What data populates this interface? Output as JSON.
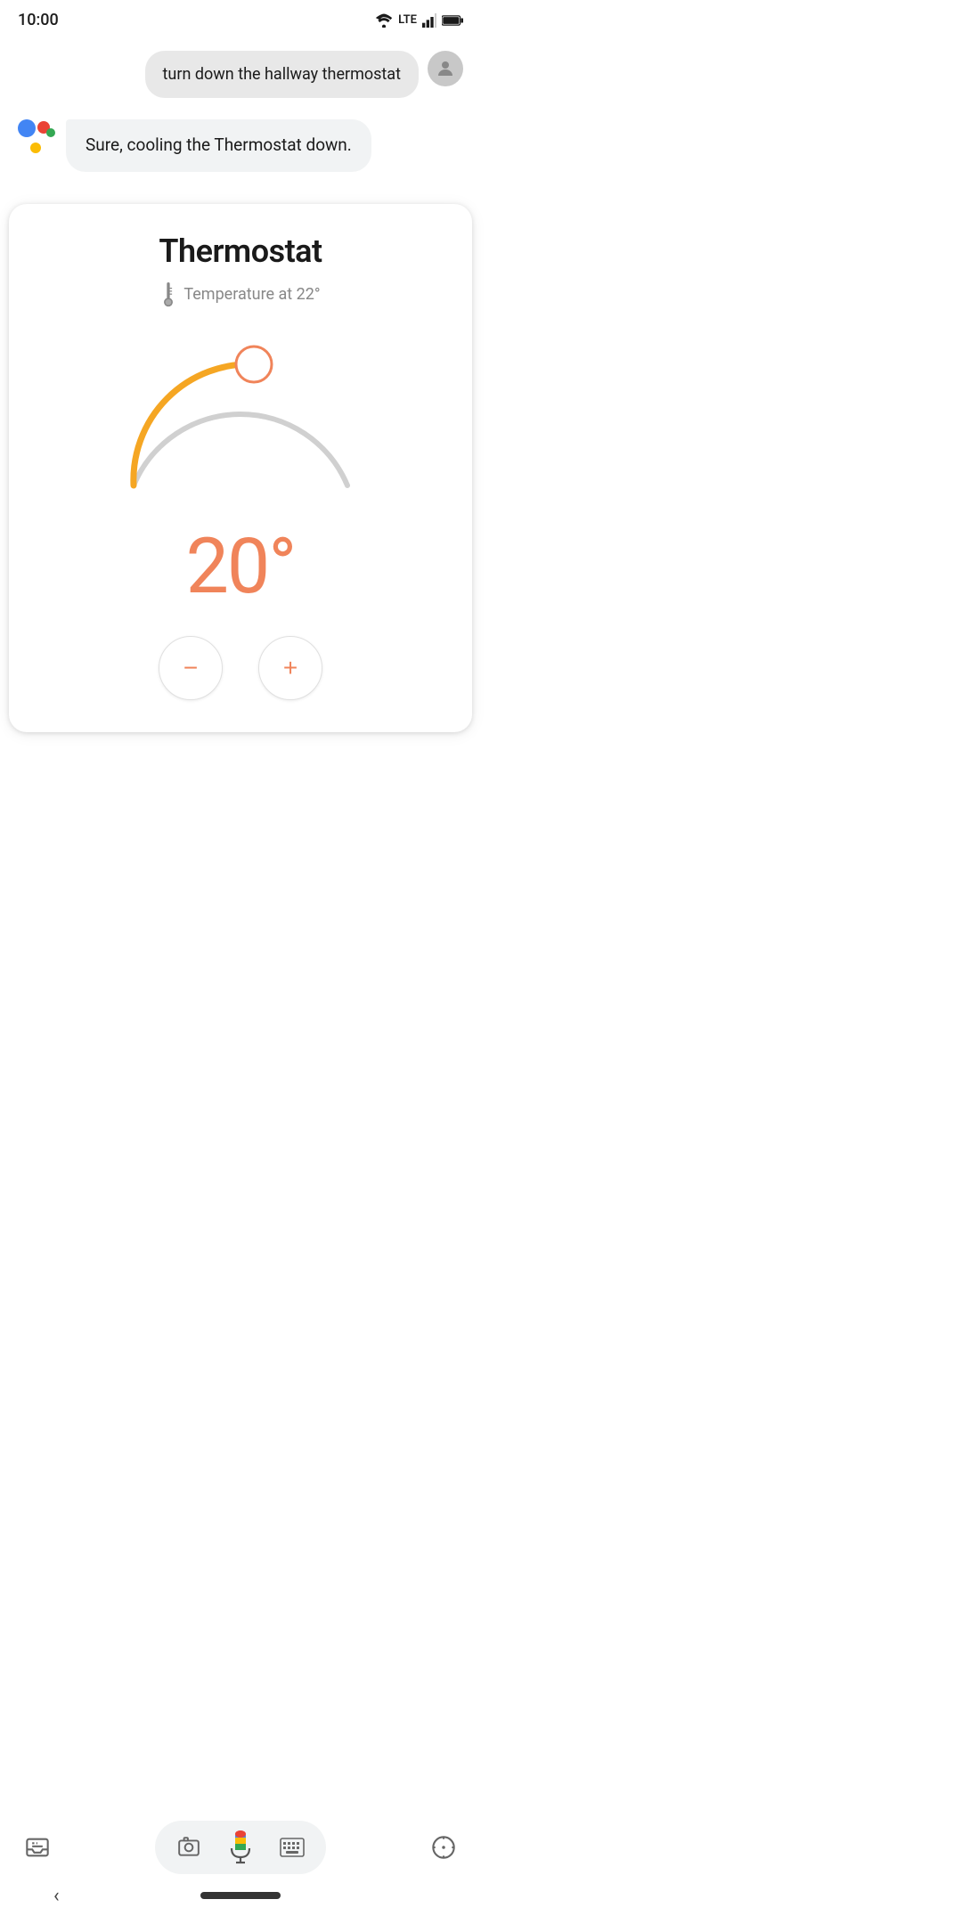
{
  "status_bar": {
    "time": "10:00",
    "wifi": "wifi",
    "lte": "LTE",
    "signal": "signal",
    "battery": "battery"
  },
  "user_message": {
    "text": "turn down the hallway thermostat"
  },
  "assistant_message": {
    "text": "Sure, cooling the Thermostat down."
  },
  "thermostat_card": {
    "title": "Thermostat",
    "temperature_label": "Temperature at 22°",
    "current_temp": "20°",
    "decrease_label": "−",
    "increase_label": "+"
  },
  "toolbar": {
    "lens_icon": "lens",
    "keyboard_icon": "keyboard",
    "compass_icon": "compass",
    "inbox_icon": "inbox"
  },
  "nav": {
    "back_label": "‹"
  }
}
